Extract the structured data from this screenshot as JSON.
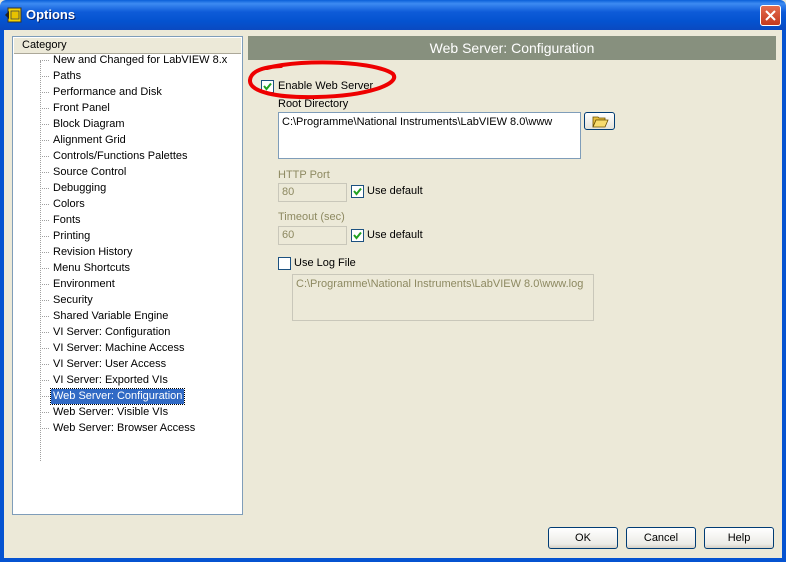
{
  "window": {
    "title": "Options",
    "app_icon": "labview-icon",
    "close_icon": "close-icon"
  },
  "category": {
    "header": "Category",
    "items": [
      "New and Changed for LabVIEW 8.x",
      "Paths",
      "Performance and Disk",
      "Front Panel",
      "Block Diagram",
      "Alignment Grid",
      "Controls/Functions Palettes",
      "Source Control",
      "Debugging",
      "Colors",
      "Fonts",
      "Printing",
      "Revision History",
      "Menu Shortcuts",
      "Environment",
      "Security",
      "Shared Variable Engine",
      "VI Server: Configuration",
      "VI Server: Machine Access",
      "VI Server: User Access",
      "VI Server: Exported VIs",
      "Web Server: Configuration",
      "Web Server: Visible VIs",
      "Web Server: Browser Access"
    ],
    "selected": "Web Server: Configuration"
  },
  "config": {
    "header": "Web Server: Configuration",
    "enable_web_server": {
      "label": "Enable Web Server",
      "checked": true
    },
    "root_directory": {
      "label": "Root Directory",
      "value": "C:\\Programme\\National Instruments\\LabVIEW 8.0\\www",
      "browse_icon": "folder-open-icon"
    },
    "http_port": {
      "label": "HTTP Port",
      "value": "80",
      "use_default_label": "Use default",
      "use_default_checked": true
    },
    "timeout": {
      "label": "Timeout (sec)",
      "value": "60",
      "use_default_label": "Use default",
      "use_default_checked": true
    },
    "use_log_file": {
      "label": "Use Log File",
      "checked": false,
      "path": "C:\\Programme\\National Instruments\\LabVIEW 8.0\\www.log"
    }
  },
  "buttons": {
    "ok": "OK",
    "cancel": "Cancel",
    "help": "Help"
  },
  "colors": {
    "titlebar": "#0553d1",
    "selection": "#316ac5",
    "header_bg": "#87907e",
    "annotation": "#ee0000"
  }
}
